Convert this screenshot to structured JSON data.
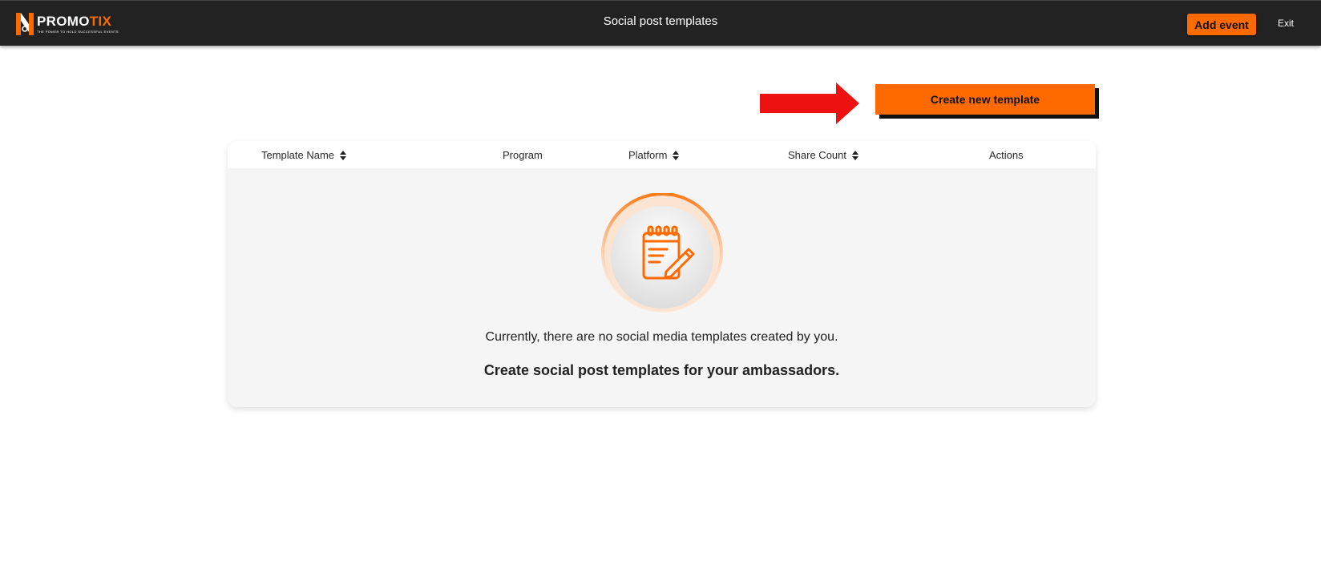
{
  "brand": {
    "word_part1": "PROMO",
    "word_part2": "TIX",
    "tagline": "The power to hold successful events",
    "accent_color": "#ff6a00"
  },
  "header": {
    "title": "Social post templates",
    "add_event_label": "Add event",
    "exit_label": "Exit"
  },
  "actions": {
    "create_template_label": "Create new template"
  },
  "table": {
    "columns": [
      {
        "label": "Template Name",
        "sortable": true
      },
      {
        "label": "Program",
        "sortable": false
      },
      {
        "label": "Platform",
        "sortable": true
      },
      {
        "label": "Share Count",
        "sortable": true
      },
      {
        "label": "Actions",
        "sortable": false
      }
    ]
  },
  "empty_state": {
    "icon": "notepad-pencil-icon",
    "message": "Currently, there are no social media templates created by you.",
    "cta_text": "Create social post templates for your ambassadors."
  }
}
